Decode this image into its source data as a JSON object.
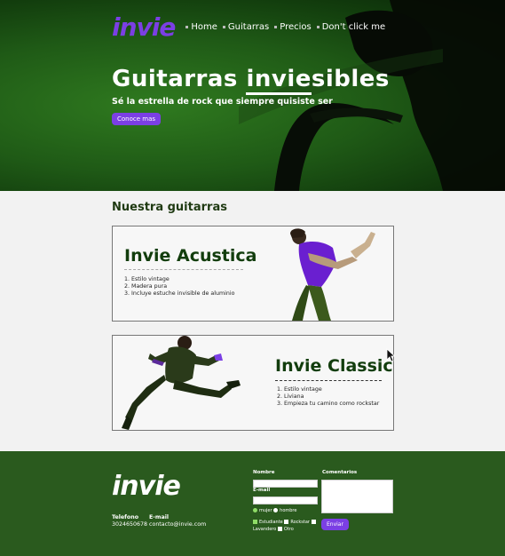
{
  "brand": {
    "logo_text": "invie",
    "accent_color": "#7b3fe4",
    "dark_green": "#123d0d"
  },
  "nav": {
    "items": [
      {
        "label": "Home"
      },
      {
        "label": "Guitarras"
      },
      {
        "label": "Precios"
      },
      {
        "label": "Don't click me"
      }
    ]
  },
  "hero": {
    "title_before": "Guitarras ",
    "title_underlined": "invie",
    "title_after": "sibles",
    "subtitle": "Sé la estrella de rock que siempre quisiste ser",
    "cta_label": "Conoce mas"
  },
  "guitars": {
    "section_title": "Nuestra guitarras",
    "items": [
      {
        "name": "Invie Acustica",
        "features": [
          "1. Estilo vintage",
          "2. Madera pura",
          "3. Incluye estuche invisible de aluminio"
        ]
      },
      {
        "name": "Invie Classic",
        "features": [
          "1. Estilo vintage",
          "2. Liviana",
          "3. Empieza tu camino como rockstar"
        ]
      }
    ]
  },
  "footer": {
    "logo_text": "invie",
    "contact": {
      "phone_label": "Telefono",
      "phone_value": "3024650678",
      "email_label": "E-mail",
      "email_value": "contacto@invie.com"
    },
    "form": {
      "name_label": "Nombre",
      "email_label": "E-mail",
      "comments_label": "Comentarios",
      "gender_options": [
        "mujer",
        "hombre"
      ],
      "interest_options": [
        "Estudiante",
        "Rockstar",
        "Lavandero",
        "Otro"
      ],
      "submit_label": "Enviar"
    }
  }
}
